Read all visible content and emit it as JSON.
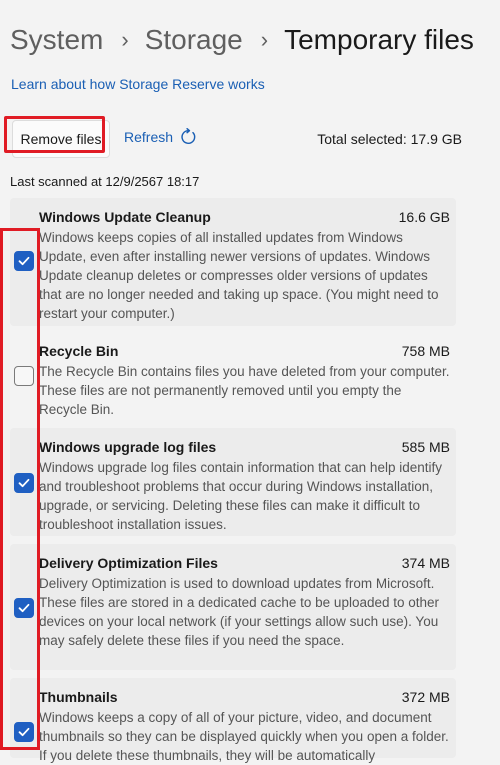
{
  "breadcrumb": {
    "items": [
      "System",
      "Storage",
      "Temporary files"
    ]
  },
  "learn_link": "Learn about how Storage Reserve works",
  "toolbar": {
    "remove_label": "Remove files",
    "refresh_label": "Refresh",
    "total_selected": "Total selected: 17.9 GB"
  },
  "last_scanned": "Last scanned at 12/9/2567 18:17",
  "items": [
    {
      "title": "Windows Update Cleanup",
      "size": "16.6 GB",
      "checked": true,
      "description": "Windows keeps copies of all installed updates from Windows Update, even after installing newer versions of updates. Windows Update cleanup deletes or compresses older versions of updates that are no longer needed and taking up space. (You might need to restart your computer.)"
    },
    {
      "title": "Recycle Bin",
      "size": "758 MB",
      "checked": false,
      "description": "The Recycle Bin contains files you have deleted from your computer. These files are not permanently removed until you empty the Recycle Bin."
    },
    {
      "title": "Windows upgrade log files",
      "size": "585 MB",
      "checked": true,
      "description": "Windows upgrade log files contain information that can help identify and troubleshoot problems that occur during Windows installation, upgrade, or servicing.  Deleting these files can make it difficult to troubleshoot installation issues."
    },
    {
      "title": "Delivery Optimization Files",
      "size": "374 MB",
      "checked": true,
      "description": "Delivery Optimization is used to download updates from Microsoft. These files are stored in a dedicated cache to be uploaded to other devices on your local network (if your settings allow such use). You may safely delete these files if you need the space."
    },
    {
      "title": "Thumbnails",
      "size": "372 MB",
      "checked": true,
      "description": "Windows keeps a copy of all of your picture, video, and document thumbnails so they can be displayed quickly when you open a folder. If you delete these thumbnails, they will be automatically"
    }
  ],
  "colors": {
    "accent": "#1f5fc2",
    "link": "#1a5fb4",
    "highlight": "#e01b24"
  }
}
